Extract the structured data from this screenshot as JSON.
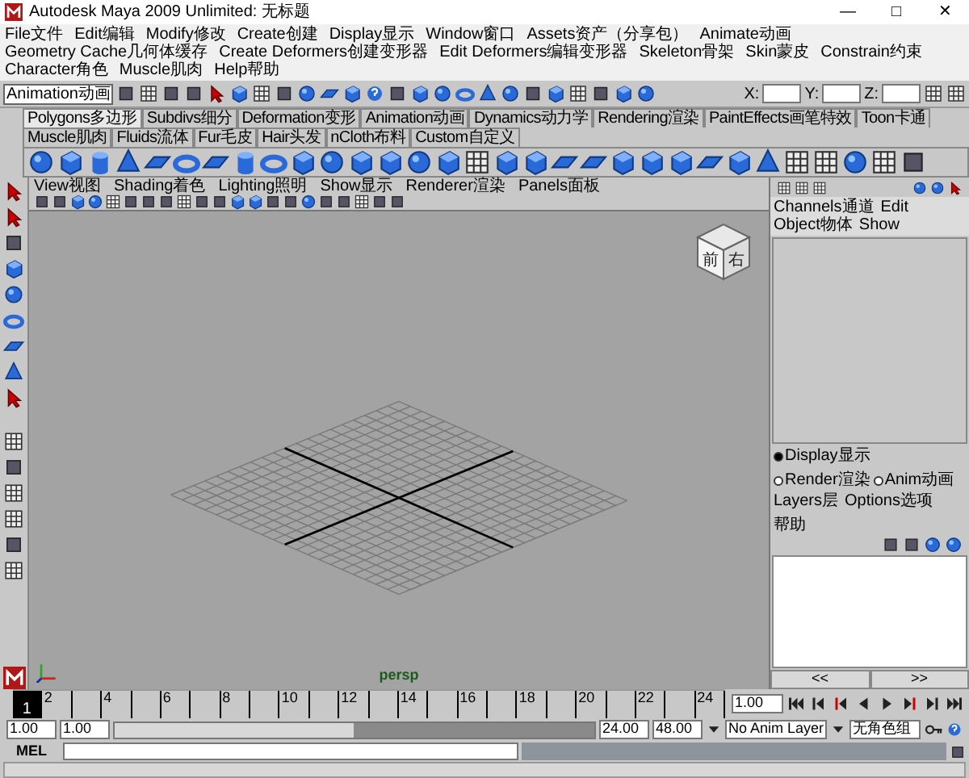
{
  "window": {
    "title": "Autodesk Maya 2009 Unlimited: 无标题",
    "controls": [
      "—",
      "□",
      "✕"
    ]
  },
  "menu_bar": [
    "File文件",
    "Edit编辑",
    "Modify修改",
    "Create创建",
    "Display显示",
    "Window窗口",
    "Assets资产（分享包）",
    "Animate动画",
    "Geometry Cache几何体缓存",
    "Create Deformers创建变形器",
    "Edit Deformers编辑变形器",
    "Skeleton骨架",
    "Skin蒙皮",
    "Constrain约束",
    "Character角色",
    "Muscle肌肉",
    "Help帮助"
  ],
  "status_line": {
    "mode": "Animation动画",
    "fields": [
      "X:",
      "Y:",
      "Z:"
    ]
  },
  "shelf": {
    "tabs": [
      {
        "label": "Polygons多边形",
        "selected": true
      },
      {
        "label": "Subdivs细分",
        "selected": false
      },
      {
        "label": "Deformation变形",
        "selected": false
      },
      {
        "label": "Animation动画",
        "selected": false
      },
      {
        "label": "Dynamics动力学",
        "selected": false
      },
      {
        "label": "Rendering渲染",
        "selected": false
      },
      {
        "label": "PaintEffects画笔特效",
        "selected": false
      },
      {
        "label": "Toon卡通",
        "selected": false
      },
      {
        "label": "Muscle肌肉",
        "selected": false
      },
      {
        "label": "Fluids流体",
        "selected": false
      },
      {
        "label": "Fur毛皮",
        "selected": false
      },
      {
        "label": "Hair头发",
        "selected": false
      },
      {
        "label": "nCloth布料",
        "selected": false
      },
      {
        "label": "Custom自定义",
        "selected": false
      }
    ]
  },
  "viewport": {
    "menus": [
      "View视图",
      "Shading着色",
      "Lighting照明",
      "Show显示",
      "Renderer渲染",
      "Panels面板"
    ],
    "view_cube": [
      "前",
      "右"
    ],
    "camera_label": "persp"
  },
  "channel_box": {
    "menus": [
      "Channels通道",
      "Edit",
      "Object物体",
      "Show"
    ]
  },
  "layer_editor": {
    "modes": [
      {
        "label": "Display显示",
        "selected": true
      },
      {
        "label": "Render渲染",
        "selected": false
      },
      {
        "label": "Anim动画",
        "selected": false
      }
    ],
    "menus": [
      "Layers层",
      "Options选项",
      "帮助"
    ],
    "nav": [
      "<<",
      ">>"
    ]
  },
  "time_slider": {
    "current_frame": "1",
    "ticks": [
      "2",
      "4",
      "6",
      "8",
      "10",
      "12",
      "14",
      "16",
      "18",
      "20",
      "22",
      "24"
    ],
    "current_time": "1.00"
  },
  "range_slider": {
    "start": "1.00",
    "playback_start": "1.00",
    "playback_end": "24.00",
    "end": "48.00",
    "level": 0.5,
    "anim_layer": "No Anim Layer",
    "character": "无角色组"
  },
  "command_line": {
    "label": "MEL"
  }
}
